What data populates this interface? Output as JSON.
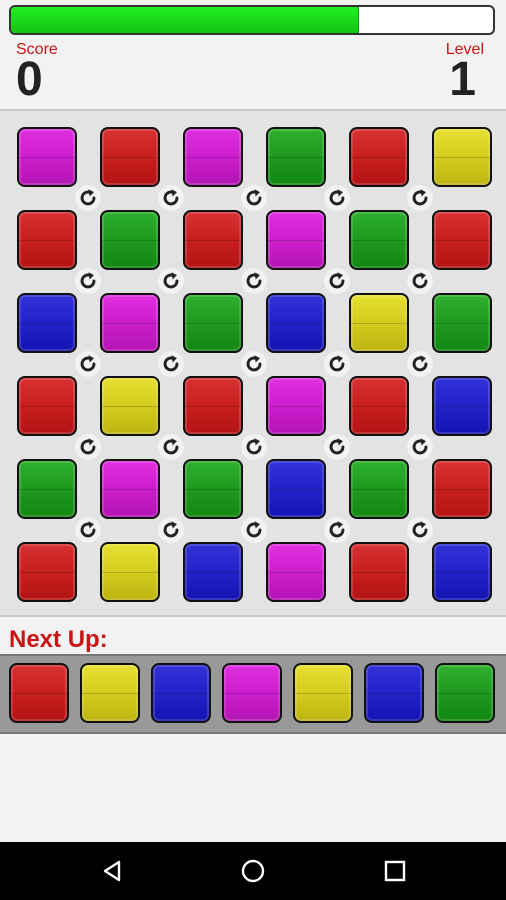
{
  "progress": {
    "fraction": 0.72
  },
  "header": {
    "score_label": "Score",
    "score_value": "0",
    "level_label": "Level",
    "level_value": "1"
  },
  "board": {
    "rows": [
      [
        "magenta",
        "red",
        "magenta",
        "green",
        "red",
        "yellow"
      ],
      [
        "red",
        "green",
        "red",
        "magenta",
        "green",
        "red"
      ],
      [
        "blue",
        "magenta",
        "green",
        "blue",
        "yellow",
        "green"
      ],
      [
        "red",
        "yellow",
        "red",
        "magenta",
        "red",
        "blue"
      ],
      [
        "green",
        "magenta",
        "green",
        "blue",
        "green",
        "red"
      ],
      [
        "red",
        "yellow",
        "blue",
        "magenta",
        "red",
        "blue"
      ]
    ],
    "rotate_icon": "rotate-icon"
  },
  "next_up": {
    "label": "Next Up:",
    "tiles": [
      "red",
      "yellow",
      "blue",
      "magenta",
      "yellow",
      "blue",
      "green"
    ]
  },
  "navbar": {
    "back_icon": "back-triangle-icon",
    "home_icon": "home-circle-icon",
    "recents_icon": "recents-square-icon"
  },
  "colors": {
    "red": "#c81e1e",
    "green": "#1e9a1e",
    "blue": "#2222c8",
    "magenta": "#cc1ecc",
    "yellow": "#d4cc1e",
    "label_red": "#c81414"
  }
}
